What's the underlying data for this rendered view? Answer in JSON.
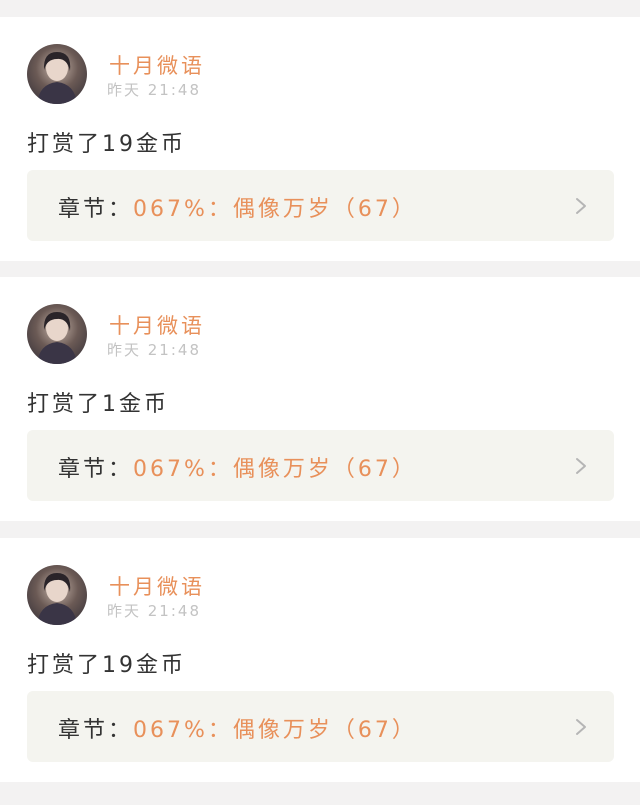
{
  "feed": [
    {
      "username": "十月微语",
      "time": "昨天 21:48",
      "reward": "打赏了19金币",
      "chapter_label": "章节：",
      "chapter_title": "067%：偶像万岁（67）",
      "avatar_icon": "user-avatar",
      "chevron_icon": "chevron-right-icon"
    },
    {
      "username": "十月微语",
      "time": "昨天 21:48",
      "reward": "打赏了1金币",
      "chapter_label": "章节：",
      "chapter_title": "067%：偶像万岁（67）",
      "avatar_icon": "user-avatar",
      "chevron_icon": "chevron-right-icon"
    },
    {
      "username": "十月微语",
      "time": "昨天 21:48",
      "reward": "打赏了19金币",
      "chapter_label": "章节：",
      "chapter_title": "067%：偶像万岁（67）",
      "avatar_icon": "user-avatar",
      "chevron_icon": "chevron-right-icon"
    }
  ],
  "colors": {
    "accent": "#e8905a",
    "text": "#333333",
    "muted": "#c3c3c3",
    "chapter_bg": "#f4f4ef",
    "page_bg": "#f3f2f2"
  }
}
